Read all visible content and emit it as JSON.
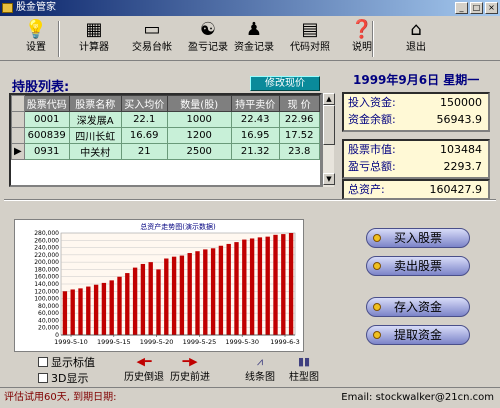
{
  "window": {
    "title": "股金管家"
  },
  "toolbar": [
    {
      "label": "设置",
      "icon": "lightbulb-icon",
      "glyph": "💡"
    },
    {
      "label": "计算器",
      "icon": "calculator-icon",
      "glyph": "▦"
    },
    {
      "label": "交易台帐",
      "icon": "ledger-icon",
      "glyph": "▭"
    },
    {
      "label": "盈亏记录",
      "icon": "yinyang-icon",
      "glyph": "☯"
    },
    {
      "label": "资金记录",
      "icon": "moneybag-icon",
      "glyph": "♟"
    },
    {
      "label": "代码对照",
      "icon": "book-icon",
      "glyph": "▤"
    },
    {
      "label": "说明",
      "icon": "help-icon",
      "glyph": "❓"
    },
    {
      "label": "退出",
      "icon": "exit-icon",
      "glyph": "⌂"
    }
  ],
  "holdings": {
    "title": "持股列表:",
    "modify_label": "修改现价",
    "columns": [
      "股票代码",
      "股票名称",
      "买入均价",
      "数量(股)",
      "持平卖价",
      "现  价"
    ],
    "rows": [
      [
        "0001",
        "深发展A",
        "22.1",
        "1000",
        "22.43",
        "22.96"
      ],
      [
        "600839",
        "四川长虹",
        "16.69",
        "1200",
        "16.95",
        "17.52"
      ],
      [
        "0931",
        "中关村",
        "21",
        "2500",
        "21.32",
        "23.8"
      ]
    ]
  },
  "summary": {
    "date": "1999年9月6日  星期一",
    "investment_label": "投入资金:",
    "investment": "150000",
    "balance_label": "资金余额:",
    "balance": "56943.9",
    "market_value_label": "股票市值:",
    "market_value": "103484",
    "pnl_label": "盈亏总额:",
    "pnl": "2293.7",
    "total_label": "总资产:",
    "total": "160427.9"
  },
  "actions": {
    "buy": "买入股票",
    "sell": "卖出股票",
    "deposit": "存入资金",
    "withdraw": "提取资金"
  },
  "chart_data": {
    "type": "bar",
    "title": "总资产走势图(演示数据)",
    "ylim": [
      0,
      280000
    ],
    "yticks": [
      0,
      20000,
      40000,
      60000,
      80000,
      100000,
      120000,
      140000,
      160000,
      180000,
      200000,
      220000,
      240000,
      260000,
      280000
    ],
    "ytick_labels": [
      "0",
      "20,000",
      "40,000",
      "60,000",
      "80,000",
      "100,000",
      "120,000",
      "140,000",
      "160,000",
      "180,000",
      "200,000",
      "220,000",
      "240,000",
      "260,000",
      "280,000"
    ],
    "xtick_labels": [
      "1999-5-10",
      "1999-5-15",
      "1999-5-20",
      "1999-5-25",
      "1999-5-30",
      "1999-6-3"
    ],
    "values": [
      120000,
      125000,
      128000,
      133000,
      138000,
      143000,
      150000,
      160000,
      170000,
      185000,
      195000,
      200000,
      180000,
      210000,
      215000,
      218000,
      225000,
      230000,
      235000,
      238000,
      245000,
      250000,
      255000,
      262000,
      265000,
      268000,
      270000,
      275000,
      277000,
      280000
    ],
    "grid": true,
    "bar_color": "#c00000"
  },
  "controls": {
    "show_values": "显示标值",
    "show_3d": "3D显示",
    "back": "历史倒退",
    "forward": "历史前进",
    "line": "线条图",
    "bar": "柱型图"
  },
  "status": {
    "left": "评估试用60天, 到期日期:",
    "right": "Email: stockwalker@21cn.com"
  }
}
